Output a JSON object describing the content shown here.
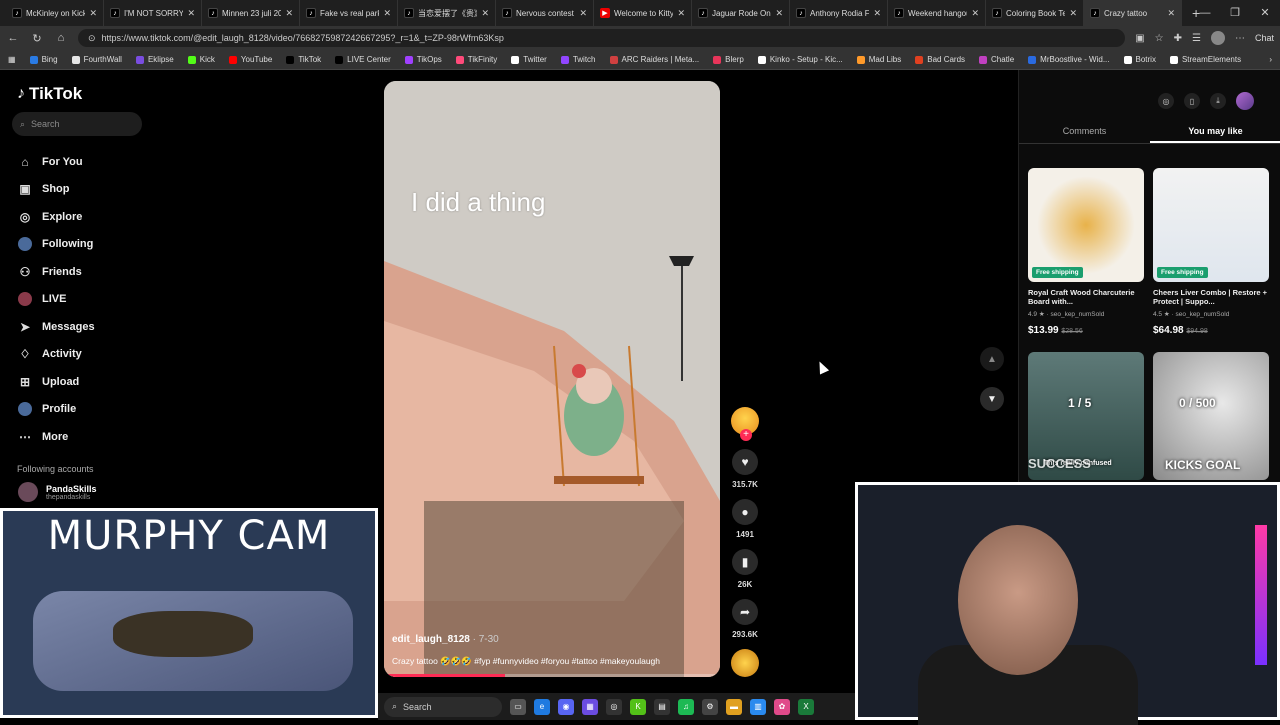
{
  "tabs": [
    {
      "label": "McKinley on Kick",
      "icon": "tiktok"
    },
    {
      "label": "I'M NOT SORRY",
      "icon": "tiktok"
    },
    {
      "label": "Minnen 23 juli 20",
      "icon": "tiktok"
    },
    {
      "label": "Fake vs real parki",
      "icon": "tiktok"
    },
    {
      "label": "当恋爱摆了《贵》",
      "icon": "tiktok"
    },
    {
      "label": "Nervous contest",
      "icon": "tiktok"
    },
    {
      "label": "Welcome to Kitty",
      "icon": "youtube"
    },
    {
      "label": "Jaguar Rode On",
      "icon": "tiktok"
    },
    {
      "label": "Anthony Rodia Fr",
      "icon": "tiktok"
    },
    {
      "label": "Weekend hangou",
      "icon": "tiktok"
    },
    {
      "label": "Coloring Book Te",
      "icon": "tiktok"
    },
    {
      "label": "Crazy tattoo",
      "icon": "tiktok",
      "active": true
    }
  ],
  "browser": {
    "url": "https://www.tiktok.com/@edit_laugh_8128/video/7668275987242667295?_r=1&_t=ZP-98rWfm63Ksp",
    "chat_label": "Chat"
  },
  "bookmarks": [
    {
      "label": "Bing",
      "color": "#2a7be4"
    },
    {
      "label": "FourthWall",
      "color": "#e6e6e6"
    },
    {
      "label": "Eklipse",
      "color": "#7a4de0"
    },
    {
      "label": "Kick",
      "color": "#53fc18"
    },
    {
      "label": "YouTube",
      "color": "#ff0000"
    },
    {
      "label": "TikTok",
      "color": "#000000"
    },
    {
      "label": "LIVE Center",
      "color": "#000000"
    },
    {
      "label": "TikOps",
      "color": "#a040ff"
    },
    {
      "label": "TikFinity",
      "color": "#ff4a7a"
    },
    {
      "label": "Twitter",
      "color": "#ffffff"
    },
    {
      "label": "Twitch",
      "color": "#9146ff"
    },
    {
      "label": "ARC Raiders | Meta...",
      "color": "#d04040"
    },
    {
      "label": "Blerp",
      "color": "#e8355a"
    },
    {
      "label": "Kinko - Setup - Kic...",
      "color": "#ffffff"
    },
    {
      "label": "Mad Libs",
      "color": "#ff9a2a"
    },
    {
      "label": "Bad Cards",
      "color": "#e04020"
    },
    {
      "label": "Chatle",
      "color": "#c040c0"
    },
    {
      "label": "MrBoostlive - Wid...",
      "color": "#2a6ae0"
    },
    {
      "label": "Botrix",
      "color": "#ffffff"
    },
    {
      "label": "StreamElements",
      "color": "#ffffff"
    }
  ],
  "sidebar": {
    "logo": "TikTok",
    "search_placeholder": "Search",
    "items": [
      {
        "label": "For You",
        "icon": "home-icon"
      },
      {
        "label": "Shop",
        "icon": "shop-icon"
      },
      {
        "label": "Explore",
        "icon": "compass-icon"
      },
      {
        "label": "Following",
        "icon": "following-icon"
      },
      {
        "label": "Friends",
        "icon": "friends-icon"
      },
      {
        "label": "LIVE",
        "icon": "live-icon"
      },
      {
        "label": "Messages",
        "icon": "messages-icon"
      },
      {
        "label": "Activity",
        "icon": "activity-icon"
      },
      {
        "label": "Upload",
        "icon": "upload-icon"
      },
      {
        "label": "Profile",
        "icon": "profile-icon"
      },
      {
        "label": "More",
        "icon": "more-icon"
      }
    ],
    "following_heading": "Following accounts",
    "account": {
      "name": "PandaSkills",
      "handle": "thepandaskills"
    }
  },
  "video": {
    "overlay_text": "I did a thing",
    "author": "edit_laugh_8128",
    "date": "7-30",
    "description": "Crazy tattoo 🤣🤣🤣 #fyp #funnyvideo #foryou #tattoo #makeyoulaugh",
    "progress_fraction": 0.36
  },
  "actions": {
    "likes": "315.7K",
    "comments": "1491",
    "bookmarks": "26K",
    "shares": "293.6K"
  },
  "right_panel": {
    "tabs": [
      "Comments",
      "You may like"
    ],
    "active_tab": "You may like",
    "products": [
      {
        "title": "Royal Craft Wood Charcuterie Board with...",
        "rating": "4.9",
        "sold": "seo_kep_numSold",
        "price": "$13.99",
        "old_price": "$28.56",
        "badge": "Free shipping"
      },
      {
        "title": "Cheers Liver Combo | Restore + Protect | Suppo...",
        "rating": "4.5",
        "sold": "seo_kep_numSold",
        "price": "$64.98",
        "old_price": "$94.98",
        "badge": "Free shipping"
      }
    ],
    "videos": [
      {
        "top": "1 / 5",
        "caption": "This really confused",
        "bottom": "SUCCESS"
      },
      {
        "top": "0 / 500",
        "bottom": "KICKS GOAL"
      }
    ]
  },
  "overlays": {
    "murphy_title": "MURPHY CAM",
    "taskbar_search": "Search"
  }
}
